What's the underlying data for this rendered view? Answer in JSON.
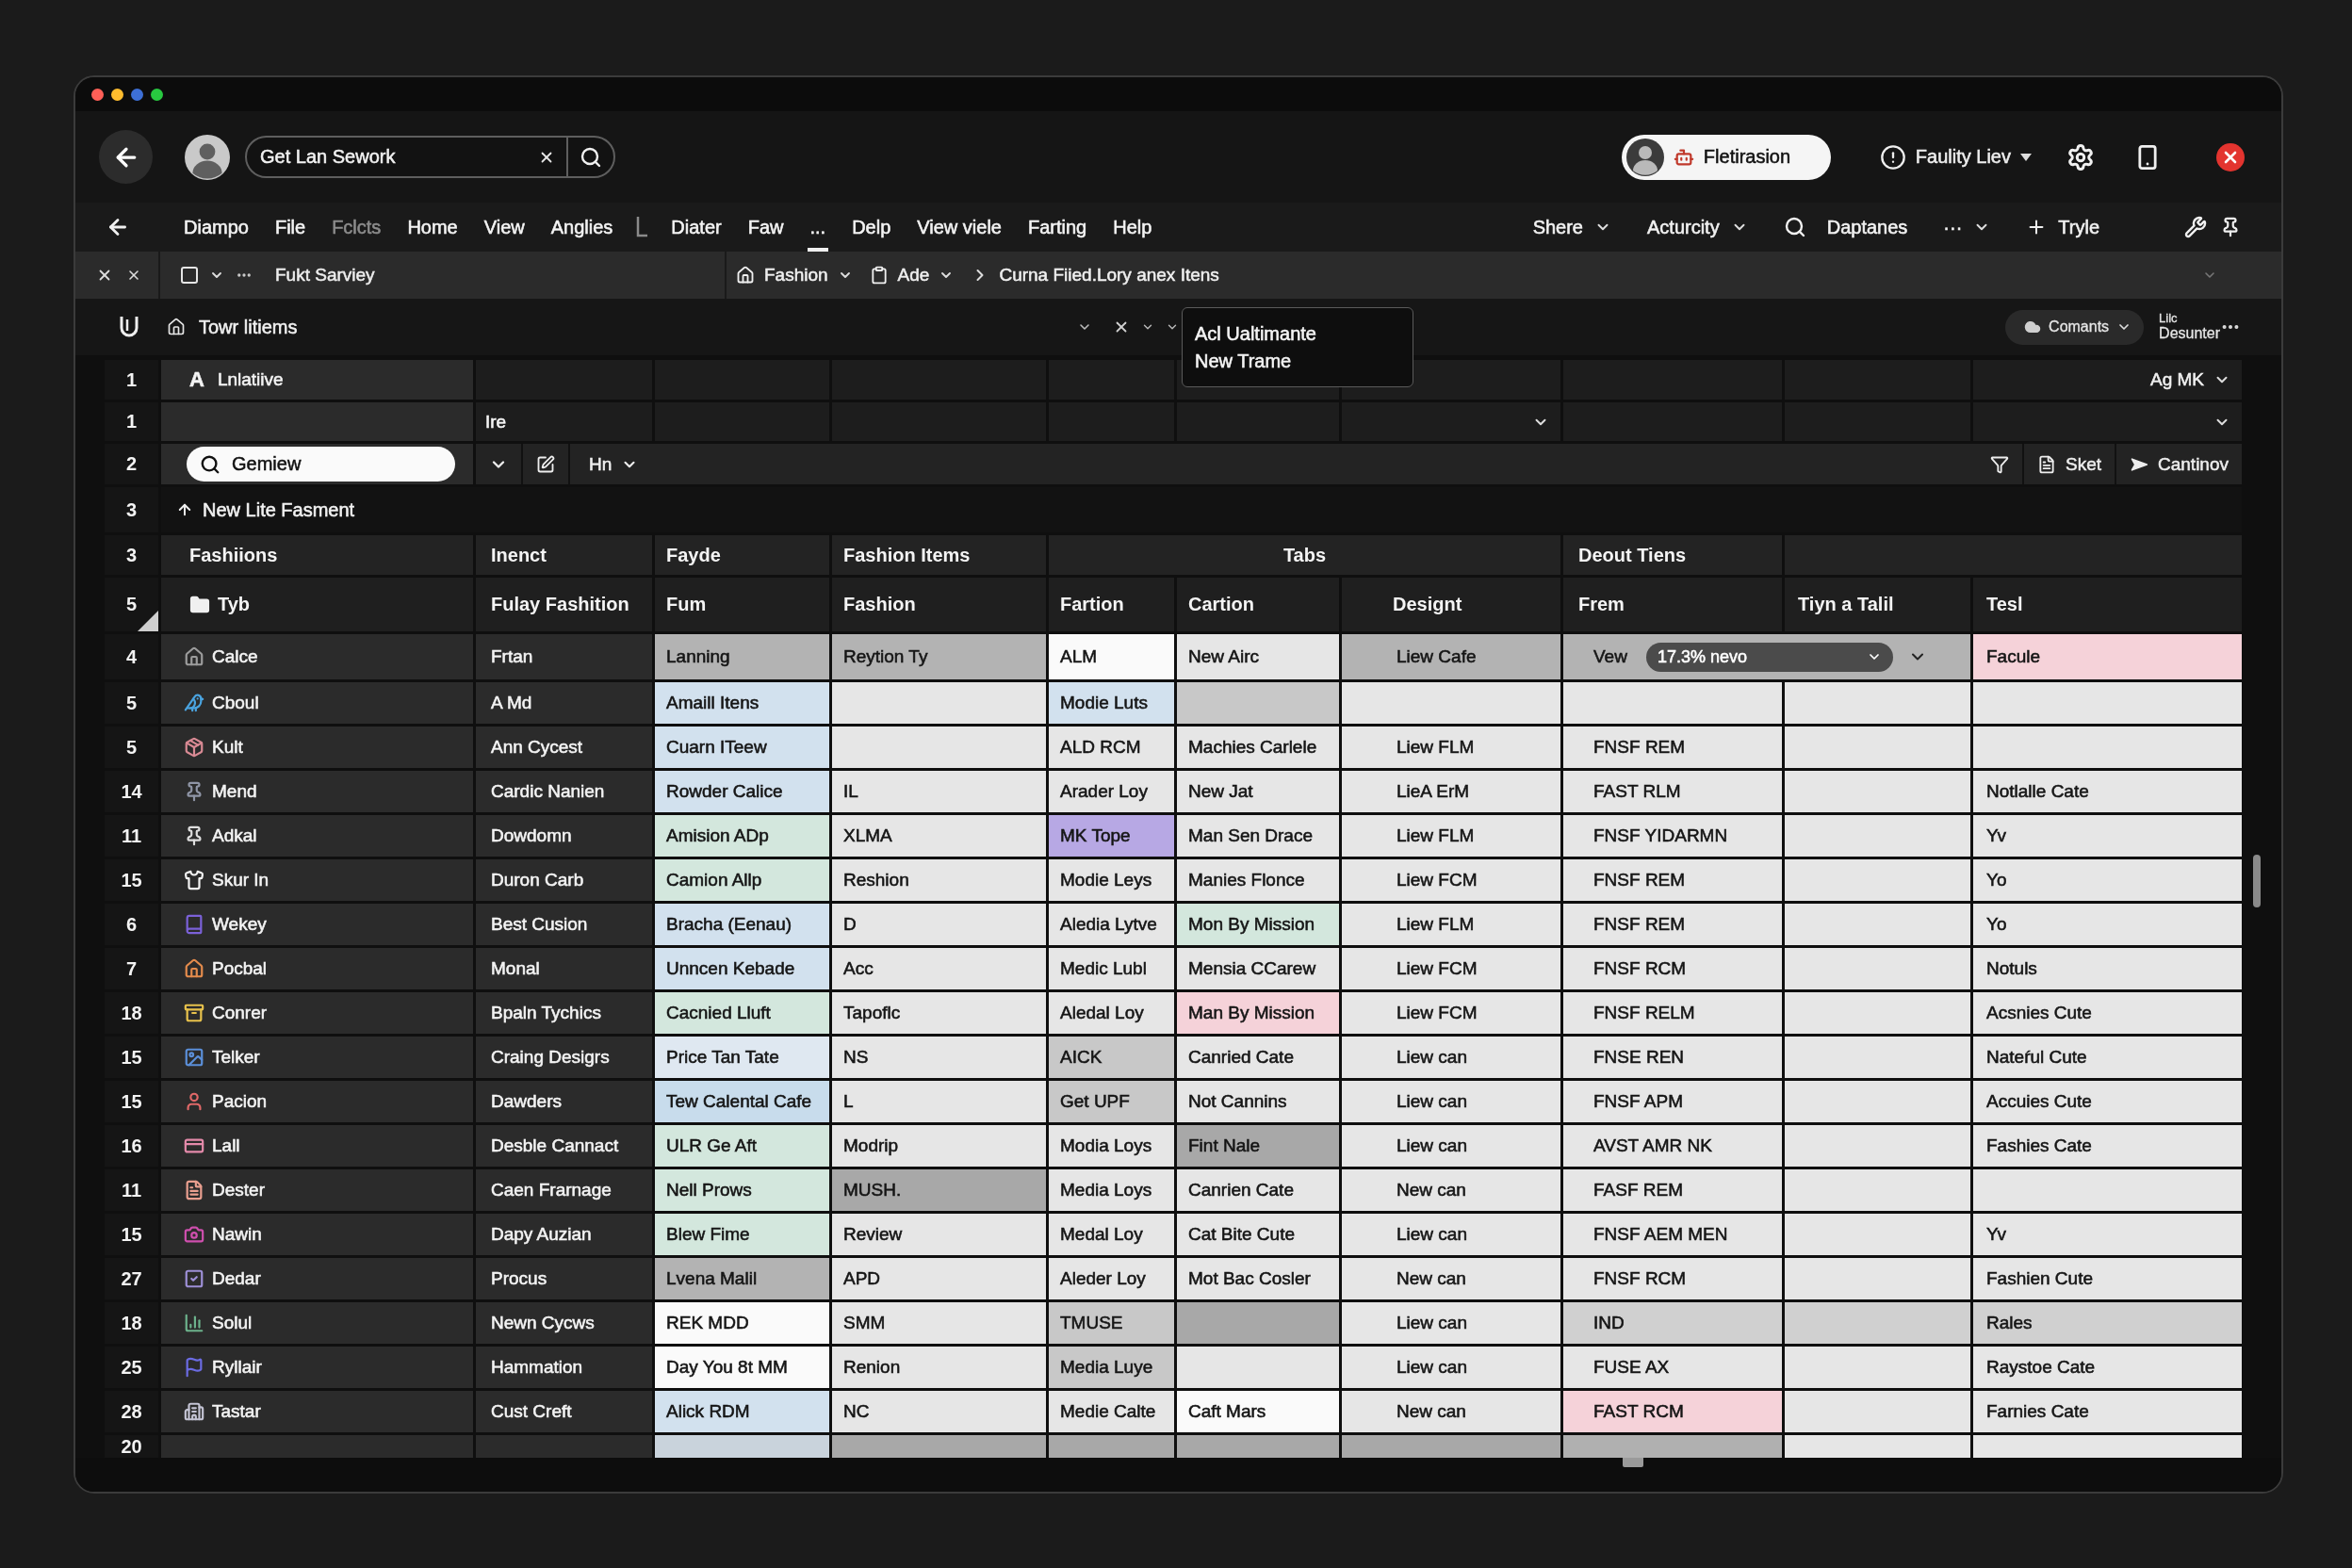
{
  "header": {
    "search": {
      "value": "Get Lan Sework"
    },
    "account": {
      "name": "Fletirasion"
    },
    "status_menu": {
      "label": "Faulity Liev"
    }
  },
  "menu_bar": {
    "items": [
      {
        "kind": "item",
        "label": "Diampo",
        "selected": false,
        "disabled": false
      },
      {
        "kind": "item",
        "label": "File",
        "selected": false,
        "disabled": false
      },
      {
        "kind": "item",
        "label": "Fclcts",
        "selected": false,
        "disabled": true
      },
      {
        "kind": "item",
        "label": "Home",
        "selected": false,
        "disabled": false
      },
      {
        "kind": "item",
        "label": "View",
        "selected": false,
        "disabled": false
      },
      {
        "kind": "item",
        "label": "Anglies",
        "selected": false,
        "disabled": false
      },
      {
        "kind": "separator"
      },
      {
        "kind": "item",
        "label": "Diater",
        "selected": false,
        "disabled": false
      },
      {
        "kind": "item",
        "label": "Faw",
        "selected": false,
        "disabled": false
      },
      {
        "kind": "item",
        "label": "...",
        "selected": true,
        "disabled": false
      },
      {
        "kind": "item",
        "label": "Delp",
        "selected": false,
        "disabled": false
      },
      {
        "kind": "item",
        "label": "View viele",
        "selected": false,
        "disabled": false
      },
      {
        "kind": "item",
        "label": "Farting",
        "selected": false,
        "disabled": false
      },
      {
        "kind": "item",
        "label": "Help",
        "selected": false,
        "disabled": false
      }
    ],
    "tools": [
      {
        "kind": "dropdown",
        "label": "Shere"
      },
      {
        "kind": "dropdown",
        "label": "Acturcity"
      },
      {
        "kind": "search",
        "label": "Daptanes"
      },
      {
        "kind": "dropdown",
        "label": "···"
      },
      {
        "kind": "add",
        "label": "Tryle"
      }
    ]
  },
  "toolbar": {
    "selection": {
      "checked": false,
      "label": "Fukt Sarviey"
    },
    "breadcrumb": [
      {
        "kind": "home",
        "label": "Fashion"
      },
      {
        "kind": "clipboard",
        "label": "Ade"
      },
      {
        "kind": "page",
        "label": "Curna Fiied.Lory anex Itens"
      }
    ]
  },
  "sheet_bar": {
    "title": "Towr litiems",
    "menu": {
      "items": [
        {
          "label": "Acl Ualtimante"
        },
        {
          "label": "New Trame"
        }
      ]
    },
    "comments": {
      "label": "Comants"
    },
    "note": {
      "lines": [
        "Lilc",
        "Desunter"
      ]
    }
  },
  "grid": {
    "name_row": {
      "row_number": "1",
      "glyph": "A",
      "label": "Lnlatiive",
      "view": {
        "label": "Ag MK"
      }
    },
    "input_row": {
      "row_number": "1",
      "value": "Ire"
    },
    "filter_row": {
      "row_number": "2",
      "search": {
        "value": "Gemiew"
      },
      "format": {
        "label": "Hn"
      },
      "actions": [
        {
          "kind": "file",
          "label": "Sket"
        },
        {
          "kind": "arrow",
          "label": "Cantinov"
        }
      ]
    },
    "section_row": {
      "row_number": "3",
      "label": "New Lite Fasment"
    },
    "group_header": {
      "row_number": "3",
      "cells": [
        {
          "label": "Fashiions"
        },
        {
          "label": "Inenct"
        },
        {
          "label": "Fayde"
        },
        {
          "label": "Fashion Items"
        },
        {
          "kind": "group",
          "label": "Tabs"
        },
        {
          "label": "Deout Tiens"
        }
      ]
    },
    "column_header": {
      "row_number": "5",
      "cells": [
        {
          "kind": "folder",
          "label": "Tyb"
        },
        {
          "label": "Fulay Fashition"
        },
        {
          "label": "Fum"
        },
        {
          "label": "Fashion"
        },
        {
          "label": "Fartion"
        },
        {
          "label": "Cartion"
        },
        {
          "label": "Designt"
        },
        {
          "label": "Frem"
        },
        {
          "label": "Tiyn a Talil"
        },
        {
          "label": "Tesl"
        }
      ]
    },
    "rows": [
      {
        "row_number": "4",
        "name": "Calce",
        "color": "#9c9c9c",
        "cells": [
          {
            "text": "Frtan"
          },
          {
            "text": "Lanning",
            "color": "#b3b3b3"
          },
          {
            "text": "Reytion Ty",
            "color": "#b3b3b3"
          },
          {
            "text": "ALM",
            "color": "#fafafa"
          },
          {
            "text": "New Airc"
          },
          {
            "text": "Liew Cafe",
            "color": "#b3b3b3"
          },
          {
            "kind": "select",
            "text": "Vew",
            "value": "17.3% nevo",
            "color": "#b3b3b3"
          },
          {
            "text": "Facule",
            "color": "#f5d2d9"
          }
        ]
      },
      {
        "row_number": "5",
        "name": "Cboul",
        "color": "#4aa3df",
        "cells": [
          {
            "text": "A Md"
          },
          {
            "text": "Amaill Itens",
            "color": "#d2e1ee"
          },
          {},
          {
            "text": "Modie Luts",
            "color": "#d2e1ee"
          },
          {
            "color": "#c8c8c8"
          },
          {},
          {},
          {},
          {}
        ]
      },
      {
        "row_number": "5",
        "name": "Kult",
        "color": "#d98a94",
        "cells": [
          {
            "text": "Ann Cycest"
          },
          {
            "text": "Cuarn ITeew",
            "color": "#d2e1ee"
          },
          {},
          {
            "text": "ALD RCM"
          },
          {
            "text": "Machies Carlele"
          },
          {
            "text": "Liew FLM"
          },
          {
            "text": "FNSF REM"
          },
          {},
          {}
        ]
      },
      {
        "row_number": "14",
        "name": "Mend",
        "color": "#8f95a6",
        "cells": [
          {
            "text": "Cardic Nanien"
          },
          {
            "text": "Rowder Calice",
            "color": "#d2e1ee"
          },
          {
            "text": "IL"
          },
          {
            "text": "Arader Loy"
          },
          {
            "text": "New Jat"
          },
          {
            "text": "LieA ErM"
          },
          {
            "text": "FAST RLM"
          },
          {},
          {
            "text": "Notlalle Cate"
          }
        ]
      },
      {
        "row_number": "11",
        "name": "Adkal",
        "color": "#dedede",
        "cells": [
          {
            "text": "Dowdomn"
          },
          {
            "text": "Amision ADp",
            "color": "#d3e7dd"
          },
          {
            "text": "XLMA"
          },
          {
            "text": "MK Tope",
            "color": "#b7a8e4"
          },
          {
            "text": "Man Sen Drace"
          },
          {
            "text": "Liew FLM"
          },
          {
            "text": "FNSF YIDARMN"
          },
          {},
          {
            "text": "Yv"
          }
        ]
      },
      {
        "row_number": "15",
        "name": "Skur In",
        "color": "#f4f4f4",
        "cells": [
          {
            "text": "Duron Carb"
          },
          {
            "text": "Camion Allp",
            "color": "#d3e7dd"
          },
          {
            "text": "Reshion"
          },
          {
            "text": "Modie Leys"
          },
          {
            "text": "Manies Flonce"
          },
          {
            "text": "Liew FCM"
          },
          {
            "text": "FNSF REM"
          },
          {},
          {
            "text": "Yo"
          }
        ]
      },
      {
        "row_number": "6",
        "name": "Wekey",
        "color": "#7b61d8",
        "cells": [
          {
            "text": "Best Cusion"
          },
          {
            "text": "Bracha (Eenau)",
            "color": "#d2e1ee"
          },
          {
            "text": "D"
          },
          {
            "text": "Aledia Lytve"
          },
          {
            "text": "Mon By Mission",
            "color": "#d3e7dd"
          },
          {
            "text": "Liew FLM"
          },
          {
            "text": "FNSF REM"
          },
          {},
          {
            "text": "Yo"
          }
        ]
      },
      {
        "row_number": "7",
        "name": "Pocbal",
        "color": "#e38b4c",
        "cells": [
          {
            "text": "Monal"
          },
          {
            "text": "Unncen Kebade",
            "color": "#d2e1ee"
          },
          {
            "text": "Acc"
          },
          {
            "text": "Medic Lubl"
          },
          {
            "text": "Mensia CCarew"
          },
          {
            "text": "Liew FCM"
          },
          {
            "text": "FNSF RCM"
          },
          {},
          {
            "text": "Notuls"
          }
        ]
      },
      {
        "row_number": "18",
        "name": "Conrer",
        "color": "#e8c24c",
        "cells": [
          {
            "text": "Bpaln Tychics"
          },
          {
            "text": "Cacnied Lluft",
            "color": "#d3e7dd"
          },
          {
            "text": "Tapoflc"
          },
          {
            "text": "Aledal Loy"
          },
          {
            "text": "Man By Mission",
            "color": "#f5d2d9"
          },
          {
            "text": "Liew FCM"
          },
          {
            "text": "FNSF RELM"
          },
          {},
          {
            "text": "Acsnies Cute"
          }
        ]
      },
      {
        "row_number": "15",
        "name": "Telker",
        "color": "#5b8fd9",
        "cells": [
          {
            "text": "Craing Desigrs"
          },
          {
            "text": "Price Tan Tate",
            "color": "#dfe8f1"
          },
          {
            "text": "NS"
          },
          {
            "text": "AICK",
            "color": "#c8c8c8"
          },
          {
            "text": "Canried Cate"
          },
          {
            "text": "Liew can"
          },
          {
            "text": "FNSE REN"
          },
          {},
          {
            "text": "Nateŕul Cute"
          }
        ]
      },
      {
        "row_number": "15",
        "name": "Pacion",
        "color": "#e06868",
        "cells": [
          {
            "text": "Dawders"
          },
          {
            "text": "Tew Calental Cafe",
            "color": "#c8dcec"
          },
          {
            "text": "L"
          },
          {
            "text": "Get UPF",
            "color": "#c8c8c8"
          },
          {
            "text": "Not Cannins"
          },
          {
            "text": "Liew can"
          },
          {
            "text": "FNSF APM"
          },
          {},
          {
            "text": "Accuies Cute"
          }
        ]
      },
      {
        "row_number": "16",
        "name": "Lall",
        "color": "#e48aaa",
        "cells": [
          {
            "text": "Desble Cannact"
          },
          {
            "text": "ULR Ge Aft",
            "color": "#d3e7dd"
          },
          {
            "text": "Modrip"
          },
          {
            "text": "Modia Loys"
          },
          {
            "text": "Fint Nale",
            "color": "#a8a8a8"
          },
          {
            "text": "Liew can"
          },
          {
            "text": "AVST AMR NK"
          },
          {},
          {
            "text": "Fashies Cate"
          }
        ]
      },
      {
        "row_number": "11",
        "name": "Dester",
        "color": "#e99f8f",
        "cells": [
          {
            "text": "Caen Frarnage"
          },
          {
            "text": "Nell Prows",
            "color": "#d3e7dd"
          },
          {
            "text": "MUSH.",
            "color": "#a8a8a8"
          },
          {
            "text": "Media Loys"
          },
          {
            "text": "Canrien Cate"
          },
          {
            "text": "New can"
          },
          {
            "text": "FASF REM"
          },
          {},
          {}
        ]
      },
      {
        "row_number": "15",
        "name": "Nawin",
        "color": "#cf4fae",
        "cells": [
          {
            "text": "Dapy Auzian"
          },
          {
            "text": "Blew Fime",
            "color": "#d3e7dd"
          },
          {
            "text": "Review"
          },
          {
            "text": "Medal Loy"
          },
          {
            "text": "Cat Bite Cute"
          },
          {
            "text": "Liew can"
          },
          {
            "text": "FNSF AEM MEN"
          },
          {},
          {
            "text": "Yv"
          }
        ]
      },
      {
        "row_number": "27",
        "name": "Dedar",
        "color": "#9d8fd6",
        "cells": [
          {
            "text": "Procus"
          },
          {
            "text": "Lvena Malil",
            "color": "#b3b3b3"
          },
          {
            "text": "APD"
          },
          {
            "text": "Aleder Loy"
          },
          {
            "text": "Mot Bac Cosler"
          },
          {
            "text": "New can"
          },
          {
            "text": "FNSF RCM"
          },
          {},
          {
            "text": "Fashien Cute"
          }
        ]
      },
      {
        "row_number": "18",
        "name": "Solul",
        "color": "#6cb28c",
        "cells": [
          {
            "text": "Newn Cycws"
          },
          {
            "text": "REK MDD",
            "color": "#fafafa"
          },
          {
            "text": "SMM"
          },
          {
            "text": "TMUSE",
            "color": "#c8c8c8"
          },
          {
            "color": "#a8a8a8"
          },
          {
            "text": "Liew can"
          },
          {
            "text": "IND",
            "color": "#d0d0d0"
          },
          {
            "color": "#d0d0d0"
          },
          {
            "text": "Rales",
            "color": "#d0d0d0"
          }
        ]
      },
      {
        "row_number": "25",
        "name": "Ryllair",
        "color": "#6b6be2",
        "cells": [
          {
            "text": "Hammation"
          },
          {
            "text": "Day You 8t MM",
            "color": "#fafafa"
          },
          {
            "text": "Renion"
          },
          {
            "text": "Media Luye",
            "color": "#c8c8c8"
          },
          {},
          {
            "text": "Liew can"
          },
          {
            "text": "FUSE AX"
          },
          {},
          {
            "text": "Raystoe Cate"
          }
        ]
      },
      {
        "row_number": "28",
        "name": "Tastar",
        "color": "#c3c3d3",
        "cells": [
          {
            "text": "Cust Creft"
          },
          {
            "text": "Alick RDM",
            "color": "#d2e1ee"
          },
          {
            "text": "NC"
          },
          {
            "text": "Medie Calte"
          },
          {
            "text": "Caft Mars",
            "color": "#fafafa"
          },
          {
            "text": "New can"
          },
          {
            "text": "FAST RCM",
            "color": "#f5d2d9"
          },
          {},
          {
            "text": "Farnies Cate"
          }
        ]
      },
      {
        "row_number": "20",
        "cells": [
          {},
          {
            "color": "#c9d3dc"
          },
          {
            "color": "#a8a8a8"
          },
          {
            "color": "#a8a8a8"
          },
          {
            "color": "#a8a8a8"
          },
          {
            "color": "#a8a8a8"
          },
          {
            "color": "#b0b0b0"
          },
          {},
          {}
        ]
      }
    ]
  }
}
